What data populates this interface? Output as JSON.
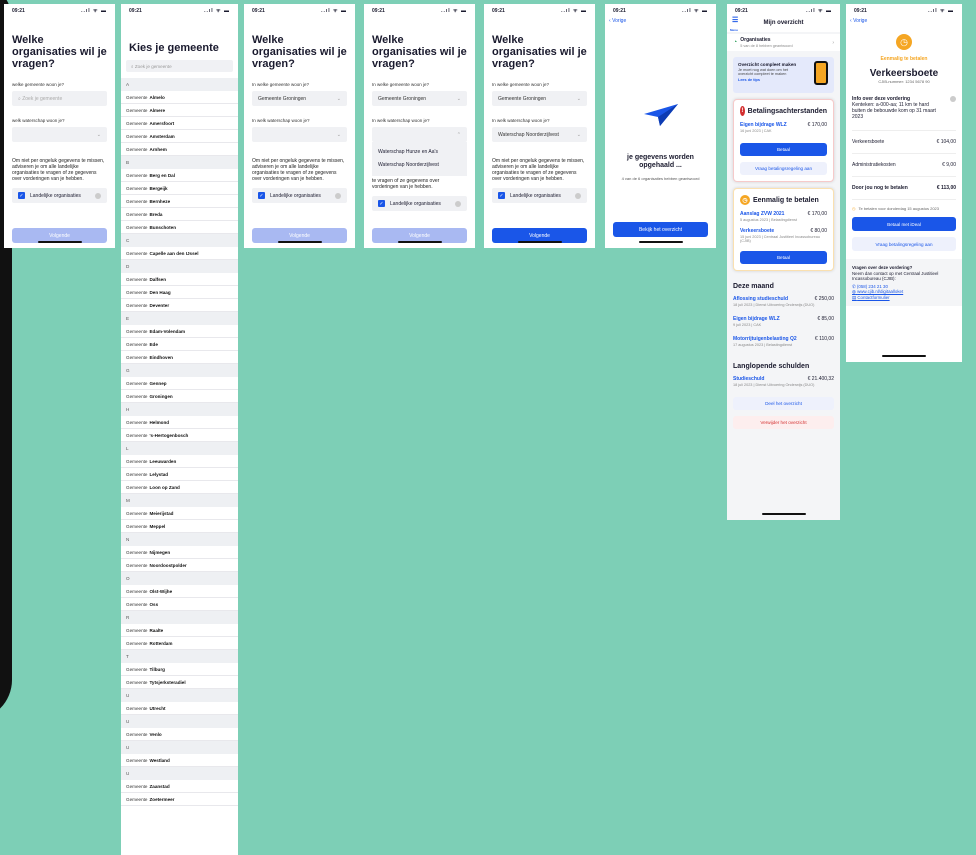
{
  "status_time": "09:21",
  "status_icons": "..ıl ᯤ ▬",
  "screen1": {
    "time": "09:21",
    "title": "Welke organisaties wil je vragen?",
    "q_gemeente": "welke gemeente woon je?",
    "placeholder_gemeente": "Zoek je gemeente",
    "q_waterschap": "welk waterschap woon je?",
    "para": "Om niet per ongeluk gegevens te missen, adviseren je om alle landelijke organisaties te vragen of ze gegevens over vorderingen van je hebben.",
    "check": "Landelijke organisaties",
    "button": "Volgende"
  },
  "screen2": {
    "time": "09:21",
    "title": "Kies je gemeente",
    "search_placeholder": "Zoek je gemeente",
    "prefix": "Gemeente",
    "groups": [
      {
        "letter": "A",
        "items": [
          "Almelo",
          "Almere",
          "Amersfoort",
          "Amsterdam",
          "Arnhem"
        ]
      },
      {
        "letter": "B",
        "items": [
          "Berg en Dal",
          "Bergeijk",
          "Bernheze",
          "Breda",
          "Bunschoten"
        ]
      },
      {
        "letter": "C",
        "items": [
          "Capelle aan den IJssel"
        ]
      },
      {
        "letter": "D",
        "items": [
          "Dalfsen",
          "Den Haag",
          "Deventer"
        ]
      },
      {
        "letter": "E",
        "items": [
          "Edam-Volendam",
          "Ede",
          "Eindhoven"
        ]
      },
      {
        "letter": "G",
        "items": [
          "Gennep",
          "Groningen"
        ]
      },
      {
        "letter": "H",
        "items": [
          "Helmond",
          "'s-Hertogenbosch"
        ]
      },
      {
        "letter": "L",
        "items": [
          "Leeuwarden",
          "Lelystad",
          "Loon op Zand"
        ]
      },
      {
        "letter": "M",
        "items": [
          "Meierijstad",
          "Meppel"
        ]
      },
      {
        "letter": "N",
        "items": [
          "Nijmegen",
          "Noordoostpolder"
        ]
      },
      {
        "letter": "O",
        "items": [
          "Olst-Wijhe",
          "Oss"
        ]
      },
      {
        "letter": "R",
        "items": [
          "Raalte",
          "Rotterdam"
        ]
      },
      {
        "letter": "T",
        "items": [
          "Tilburg",
          "Tytsjerksteradiel"
        ]
      },
      {
        "letter": "U",
        "items": [
          "Utrecht"
        ]
      },
      {
        "letter": "U",
        "items": [
          "Venlo"
        ]
      },
      {
        "letter": "U",
        "items": [
          "Westland"
        ]
      },
      {
        "letter": "U",
        "items": [
          "Zaanstad",
          "Zoetermeer"
        ]
      }
    ]
  },
  "screen3": {
    "time": "09:21",
    "title": "Welke organisaties wil je vragen?",
    "q_gemeente": "In welke gemeente woon je?",
    "gemeente_value": "Gemeente Groningen",
    "q_waterschap": "In welk waterschap woon je?",
    "para": "Om niet per ongeluk gegevens te missen, adviseren je om alle landelijke organisaties te vragen of ze gegevens over vorderingen van je hebben.",
    "check": "Landelijke organisaties",
    "button": "Volgende"
  },
  "screen4": {
    "time": "09:21",
    "title": "Welke organisaties wil je vragen?",
    "q_gemeente": "In welke gemeente woon je?",
    "gemeente_value": "Gemeente Groningen",
    "q_waterschap": "In welk waterschap woon je?",
    "options": [
      "Waterschap Hunze en Aa's",
      "Waterschap Noorderzijlvest"
    ],
    "para": "te vragen of ze gegevens over vorderingen van je hebben.",
    "check": "Landelijke organisaties",
    "button": "Volgende"
  },
  "screen5": {
    "time": "09:21",
    "title": "Welke organisaties wil je vragen?",
    "q_gemeente": "In welke gemeente woon je?",
    "gemeente_value": "Gemeente Groningen",
    "q_waterschap": "In welk waterschap woon je?",
    "waterschap_value": "Waterschap Noorderzijlvest",
    "para": "Om niet per ongeluk gegevens te missen, adviseren je om alle landelijke organisaties te vragen of ze gegevens over vorderingen van je hebben.",
    "check": "Landelijke organisaties",
    "button": "Volgende"
  },
  "screen6": {
    "time": "09:21",
    "back": "Vorige",
    "title": "je gegevens worden opgehaald ...",
    "sub": "4 van de 6 organisaties hebben geantwoord",
    "button": "Bekijk het overzicht"
  },
  "screen7": {
    "time": "09:21",
    "menu": "Menu",
    "title": "Mijn overzicht",
    "org_title": "Organisaties",
    "org_sub": "5 van de 8 hebben geantwoord",
    "promo_title": "Overzicht compleet maken",
    "promo_text": "Je moet nog wat doen om het overzicht compleet te maken",
    "promo_link": "Lees de tips",
    "ach_title": "Betalingsachterstanden",
    "ach_item": "Eigen bijdrage WLZ",
    "ach_amount": "€ 170,00",
    "ach_sub": "16 juni 2023 | CAK",
    "pay": "Betaal",
    "regeling": "Vraag betalingsregeling aan",
    "em_title": "Eenmalig te betalen",
    "em1": "Aanslag ZVW 2021",
    "em1_amount": "€ 170,00",
    "em1_sub": "5 augustus 2023 | Belastingdienst",
    "em2": "Verkeersboete",
    "em2_amount": "€ 80,00",
    "em2_sub": "15 juni 2023 | Centraal Justitieel Incassobureau (CJIB)",
    "month_title": "Deze maand",
    "m1": "Aflossing studieschuld",
    "m1_amount": "€ 250,00",
    "m1_sub": "18 juli 2023 | Dienst Uitvoering Onderwijs (DUO)",
    "m2": "Eigen bijdrage WLZ",
    "m2_amount": "€ 85,00",
    "m2_sub": "9 juli 2023 | CAK",
    "m3": "Motorrijtuigenbelasting Q2",
    "m3_amount": "€ 110,00",
    "m3_sub": "17 augustus 2023 | Belastingdienst",
    "long_title": "Langlopende schulden",
    "l1": "Studieschuld",
    "l1_amount": "€ 21.400,32",
    "l1_sub": "18 juli 2023 | Dienst Uitvoering Onderwijs (DUO)",
    "share": "Deel het overzicht",
    "delete": "Verwijder het overzicht"
  },
  "screen8": {
    "time": "09:21",
    "back": "Vorige",
    "kind": "Eenmalig te betalen",
    "title": "Verkeersboete",
    "cjib": "CJIB-nummer: 1234 5678 90",
    "info_title": "Info over deze vordering",
    "info_text": "Kenteken: a-000-aa; 11 km te hard buiten de bebouwde kom op 31 maart 2023",
    "r1": "Verkeersboete",
    "r1_amount": "€ 104,00",
    "r2": "Administratiekosten",
    "r2_amount": "€ 9,00",
    "r3": "Door jou nog te betalen",
    "r3_amount": "€ 113,00",
    "due": "Te betalen voor donderdag 15 augustus 2023",
    "ideal": "Betaal met iDeal",
    "regeling": "Vraag betalingsregeling aan",
    "q": "Vragen over deze vordering?",
    "q_text": "Neem dan contact op met Centraal Justitieel Incassobureau (CJIB):",
    "phone": "(058) 234 21 30",
    "web": "www.cjib.nl/digitaalloket",
    "form": "Contactformulier"
  },
  "colors": {
    "background": "#7dcfb6",
    "primary": "#1a56e8",
    "danger": "#d32f2f",
    "warning": "#f5a623"
  }
}
